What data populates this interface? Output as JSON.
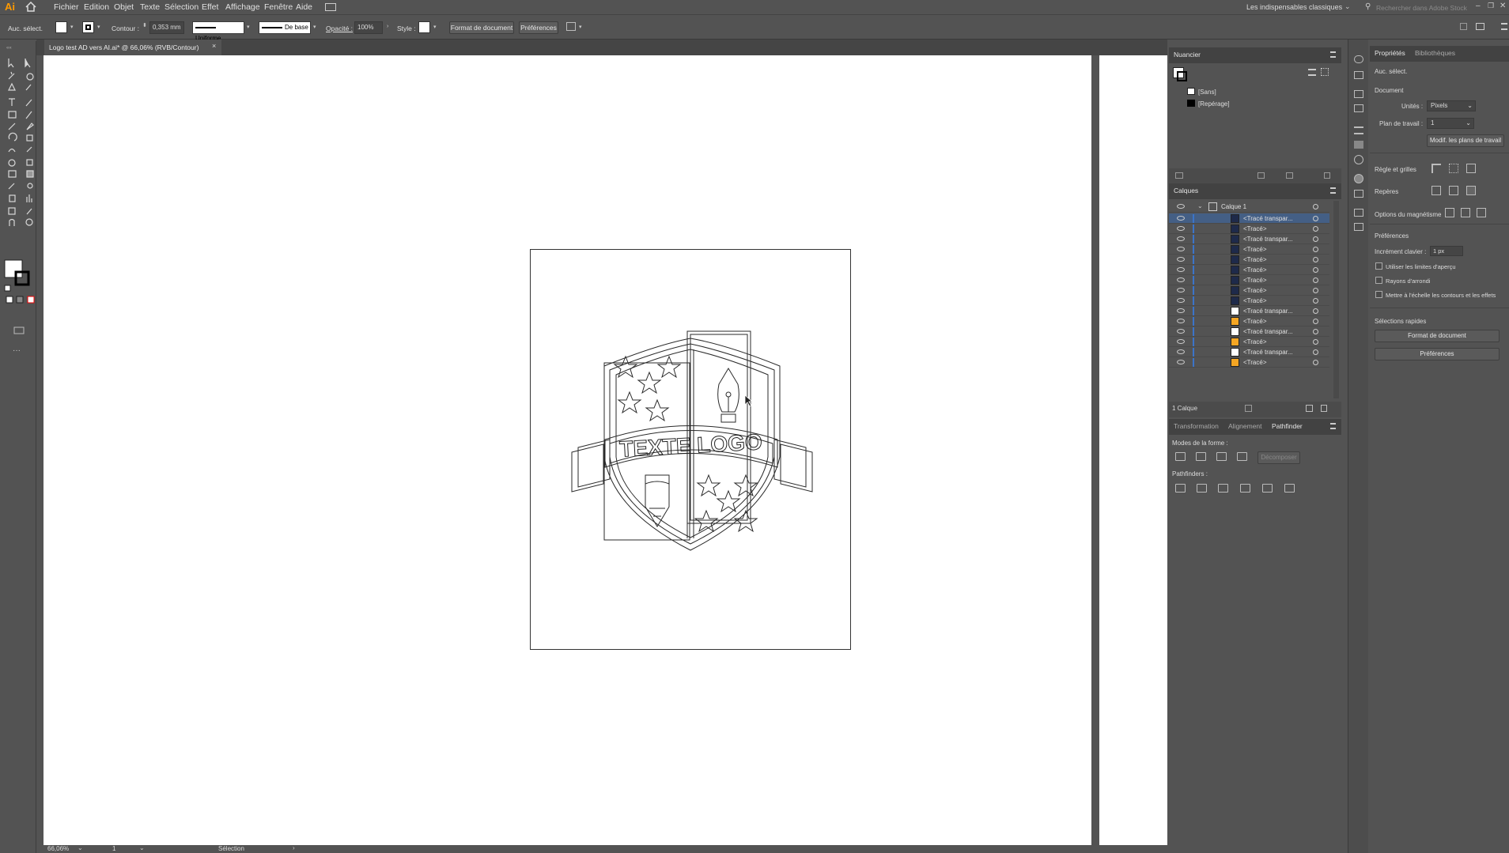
{
  "app": {
    "logo": "Ai"
  },
  "menu": [
    "Fichier",
    "Edition",
    "Objet",
    "Texte",
    "Sélection",
    "Effet",
    "Affichage",
    "Fenêtre",
    "Aide"
  ],
  "workspace": {
    "label": "Les indispensables classiques",
    "search_placeholder": "Rechercher dans Adobe Stock"
  },
  "control": {
    "selection": "Auc. sélect.",
    "stroke_label": "Contour :",
    "stroke_value": "0,353 mm",
    "profile": "Uniforme",
    "brush": "De base",
    "opacity_label": "Opacité :",
    "opacity_value": "100%",
    "style_label": "Style :",
    "doc_format_btn": "Format de document",
    "prefs_btn": "Préférences"
  },
  "document": {
    "tab_title": "Logo test AD vers AI.ai* @ 66,06% (RVB/Contour)"
  },
  "status": {
    "zoom": "66,06%",
    "artboard": "1",
    "tool": "Sélection"
  },
  "swatches": {
    "title": "Nuancier",
    "items": [
      {
        "label": "[Sans]"
      },
      {
        "label": "[Repérage]"
      }
    ]
  },
  "layers": {
    "title": "Calques",
    "layer_name": "Calque 1",
    "rows": [
      "<Tracé transpar...",
      "<Tracé>",
      "<Tracé transpar...",
      "<Tracé>",
      "<Tracé>",
      "<Tracé>",
      "<Tracé>",
      "<Tracé>",
      "<Tracé>",
      "<Tracé transpar...",
      "<Tracé>",
      "<Tracé transpar...",
      "<Tracé>",
      "<Tracé transpar...",
      "<Tracé>"
    ],
    "count": "1 Calque"
  },
  "pathfinder": {
    "tabs": [
      "Transformation",
      "Alignement",
      "Pathfinder"
    ],
    "shape_modes": "Modes de la forme :",
    "expand_btn": "Décomposer",
    "pathfinders": "Pathfinders :"
  },
  "properties": {
    "tabs": [
      "Propriétés",
      "Bibliothèques"
    ],
    "selection": "Auc. sélect.",
    "document": "Document",
    "units_label": "Unités :",
    "units_value": "Pixels",
    "artboard_label": "Plan de travail :",
    "artboard_value": "1",
    "edit_artboards_btn": "Modif. les plans de travail",
    "rulers_grids": "Règle et grilles",
    "guides": "Repères",
    "snap_options": "Options du magnétisme",
    "preferences": "Préférences",
    "keyboard_increment_label": "Incrément clavier :",
    "keyboard_increment_value": "1 px",
    "chk_preview_bounds": "Utiliser les limites d'aperçu",
    "chk_round_corners": "Rayons d'arrondi",
    "chk_scale_strokes": "Mettre à l'échelle les contours et les effets",
    "quick_actions": "Sélections rapides",
    "doc_format_btn": "Format de document",
    "prefs_btn": "Préférences"
  },
  "artwork": {
    "logo_text": "TEXTE LOGO"
  }
}
